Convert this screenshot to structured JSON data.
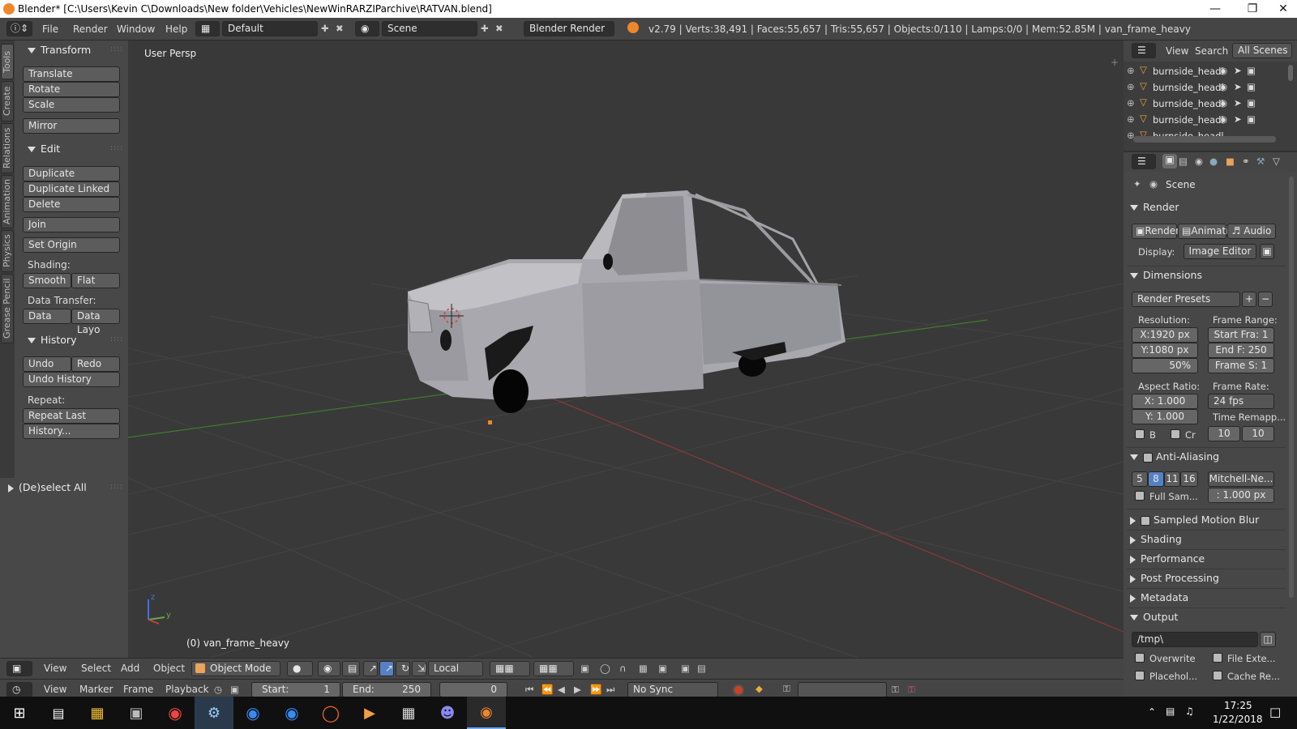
{
  "window": {
    "title": "Blender* [C:\\Users\\Kevin C\\Downloads\\New folder\\Vehicles\\NewWinRARZIParchive\\RATVAN.blend]"
  },
  "info_header": {
    "menu": [
      "File",
      "Render",
      "Window",
      "Help"
    ],
    "layout": "Default",
    "scene": "Scene",
    "engine": "Blender Render",
    "stats": "v2.79 | Verts:38,491 | Faces:55,657 | Tris:55,657 | Objects:0/110 | Lamps:0/0 | Mem:52.85M | van_frame_heavy"
  },
  "left_tabs": [
    "Tools",
    "Create",
    "Relations",
    "Animation",
    "Physics",
    "Grease Pencil"
  ],
  "tool_shelf": {
    "transform": {
      "title": "Transform",
      "buttons": [
        "Translate",
        "Rotate",
        "Scale",
        "Mirror"
      ]
    },
    "edit": {
      "title": "Edit",
      "buttons": [
        "Duplicate",
        "Duplicate Linked",
        "Delete",
        "Join"
      ],
      "set_origin": "Set Origin",
      "shading_label": "Shading:",
      "smooth": "Smooth",
      "flat": "Flat",
      "data_transfer_label": "Data Transfer:",
      "data": "Data",
      "data_layo": "Data Layo"
    },
    "history": {
      "title": "History",
      "undo": "Undo",
      "redo": "Redo",
      "undo_history": "Undo History",
      "repeat_label": "Repeat:",
      "repeat_last": "Repeat Last",
      "history_btn": "History..."
    },
    "deselect": "(De)select All"
  },
  "viewport": {
    "label": "User Persp",
    "object": "(0) van_frame_heavy",
    "axis_z": "z",
    "axis_y": "y"
  },
  "outliner": {
    "view": "View",
    "search": "Search",
    "scope": "All Scenes",
    "items": [
      "burnside_headl",
      "burnside_headl",
      "burnside_headl",
      "burnside_headl",
      "burnside_headl"
    ]
  },
  "properties": {
    "context": "Scene",
    "render": {
      "title": "Render",
      "render_btn": "Render",
      "anim_btn": "Animati",
      "audio_btn": "Audio",
      "display_label": "Display:",
      "display_value": "Image Editor"
    },
    "dimensions": {
      "title": "Dimensions",
      "presets": "Render Presets",
      "resolution_label": "Resolution:",
      "res_x": "X:1920 px",
      "res_y": "Y:1080 px",
      "res_pct": "50%",
      "frame_range_label": "Frame Range:",
      "start": "Start Fra: 1",
      "end": "End F: 250",
      "step": "Frame S: 1",
      "aspect_label": "Aspect Ratio:",
      "asp_x": "X:",
      "asp_x_val": "1.000",
      "asp_y": "Y:",
      "asp_y_val": "1.000",
      "frame_rate_label": "Frame Rate:",
      "fps": "24 fps",
      "time_remap": "Time Remapp...",
      "b": "B",
      "cr": "Cr",
      "remap_old": "10",
      "remap_new": "10"
    },
    "anti_aliasing": {
      "title": "Anti-Aliasing",
      "samples": [
        "5",
        "8",
        "11",
        "16"
      ],
      "selected": "8",
      "filter": "Mitchell-Ne...",
      "full_sample": "Full Sam...",
      "filter_size": ": 1.000 px"
    },
    "collapsed": [
      "Sampled Motion Blur",
      "Shading",
      "Performance",
      "Post Processing",
      "Metadata"
    ],
    "output": {
      "title": "Output",
      "path": "/tmp\\",
      "overwrite": "Overwrite",
      "file_ext": "File Exte...",
      "placeholders": "Placehol...",
      "cache": "Cache Re..."
    }
  },
  "view_header": {
    "menu": [
      "View",
      "Select",
      "Add",
      "Object"
    ],
    "mode": "Object Mode",
    "orientation": "Local"
  },
  "timeline": {
    "menu": [
      "View",
      "Marker",
      "Frame",
      "Playback"
    ],
    "start_label": "Start:",
    "start_val": "1",
    "end_label": "End:",
    "end_val": "250",
    "current": "0",
    "sync": "No Sync"
  },
  "taskbar": {
    "time": "17:25",
    "date": "1/22/2018"
  },
  "colors": {
    "accent_blue": "#5680c2",
    "blender_orange": "#f0862a",
    "grid_red": "#8a3a3a",
    "grid_green": "#3f7a2b"
  }
}
